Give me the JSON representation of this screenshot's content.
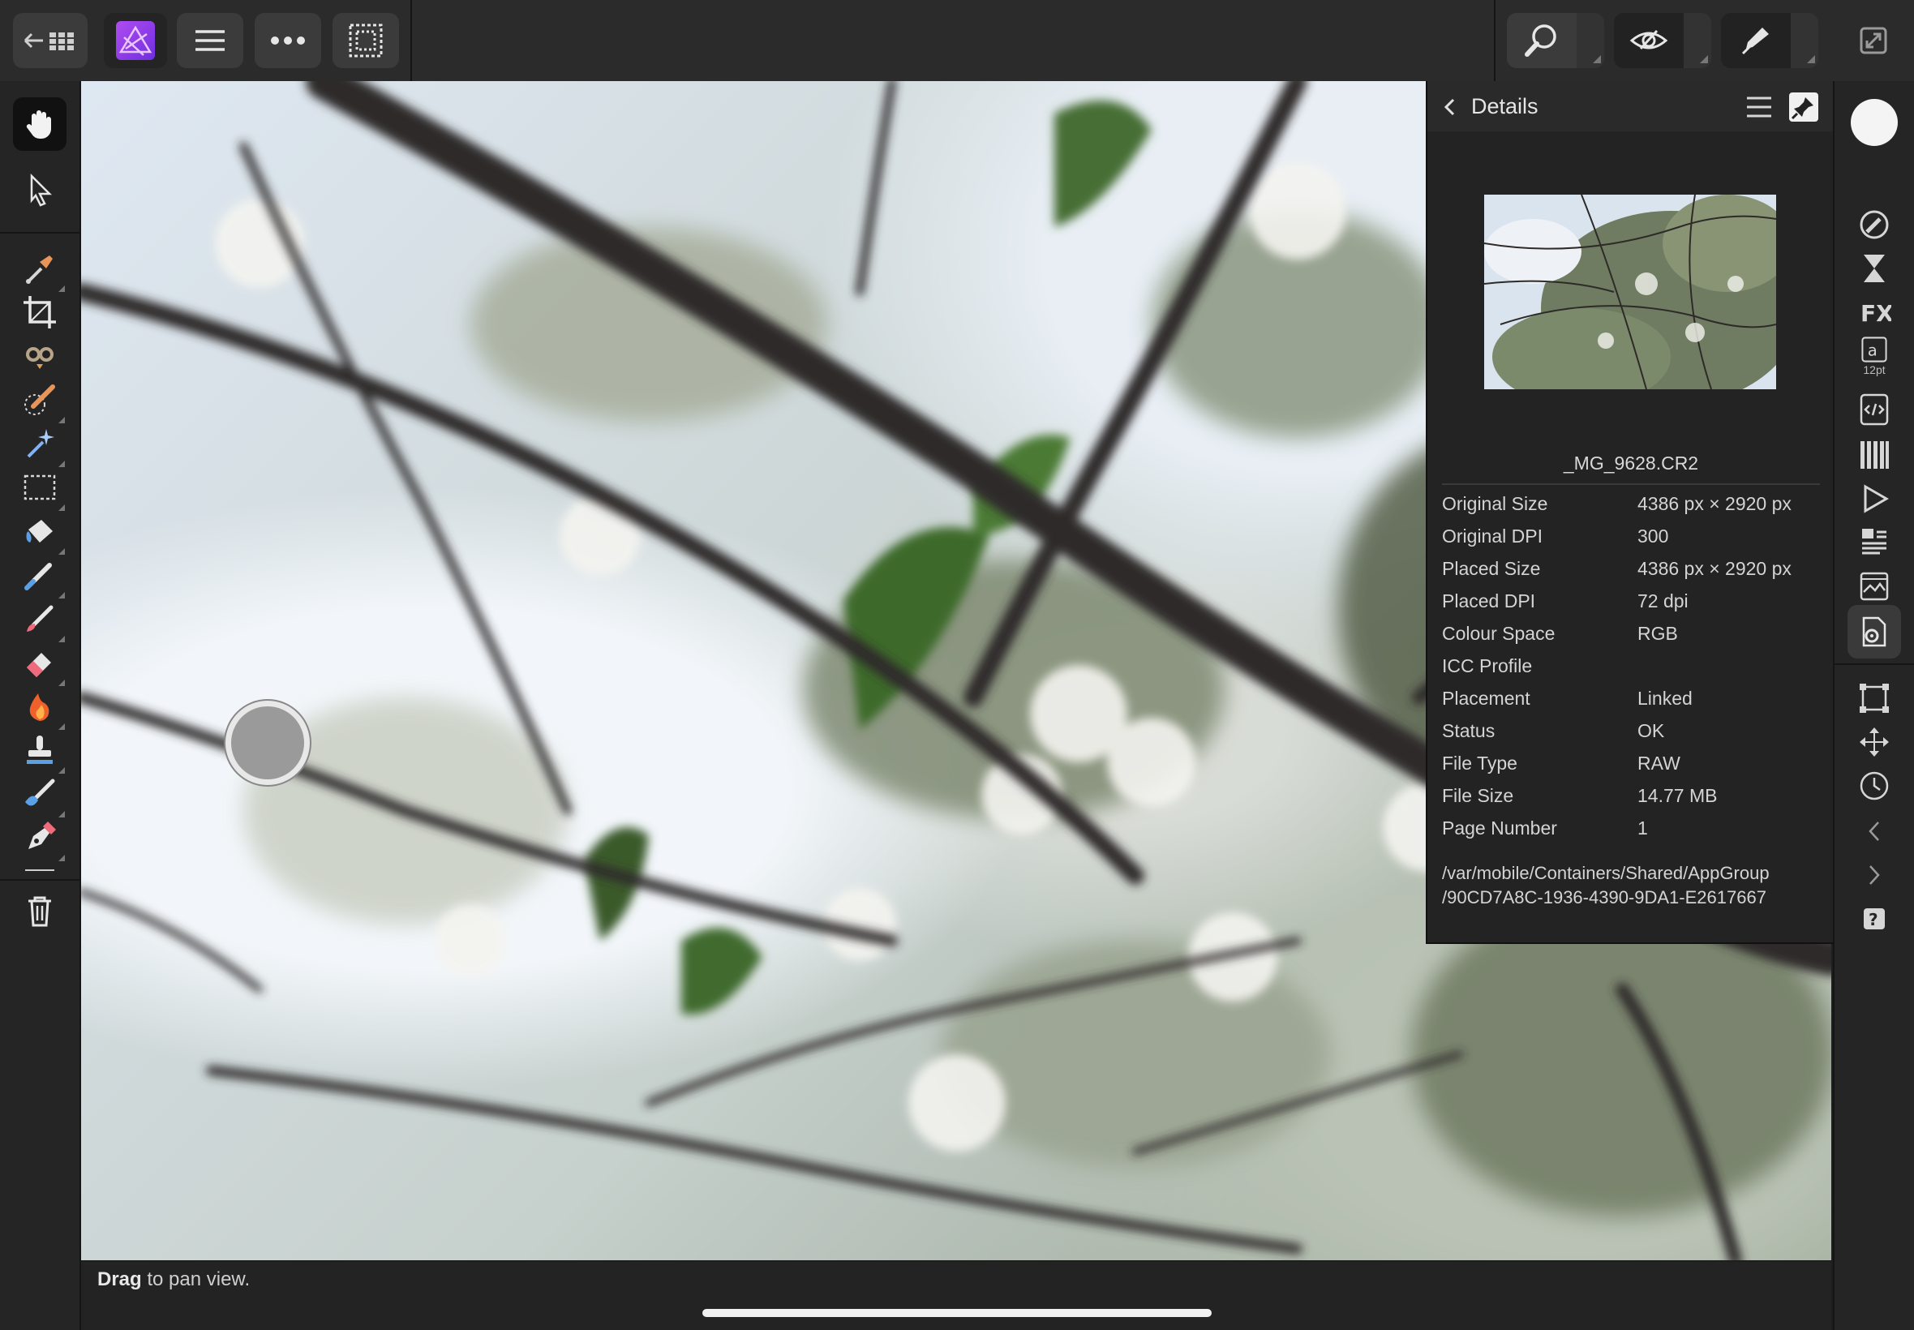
{
  "details": {
    "title": "Details",
    "filename": "_MG_9628.CR2",
    "rows": [
      {
        "label": "Original Size",
        "value": "4386 px × 2920 px"
      },
      {
        "label": "Original DPI",
        "value": "300"
      },
      {
        "label": "Placed Size",
        "value": "4386 px × 2920 px"
      },
      {
        "label": "Placed DPI",
        "value": "72 dpi"
      },
      {
        "label": "Colour Space",
        "value": "RGB"
      },
      {
        "label": "ICC Profile",
        "value": ""
      },
      {
        "label": "Placement",
        "value": "Linked"
      },
      {
        "label": "Status",
        "value": "OK"
      },
      {
        "label": "File Type",
        "value": "RAW"
      },
      {
        "label": "File Size",
        "value": "14.77 MB"
      },
      {
        "label": "Page Number",
        "value": "1"
      }
    ],
    "path_line1": "/var/mobile/Containers/Shared/AppGroup",
    "path_line2": "/90CD7A8C-1936-4390-9DA1-E2617667"
  },
  "statusbar": {
    "bold": "Drag",
    "rest": " to pan view."
  },
  "studio": {
    "text_size_label": "12pt"
  },
  "colors": {
    "accent": "#8a3ff5",
    "panel_bg": "#232323"
  }
}
